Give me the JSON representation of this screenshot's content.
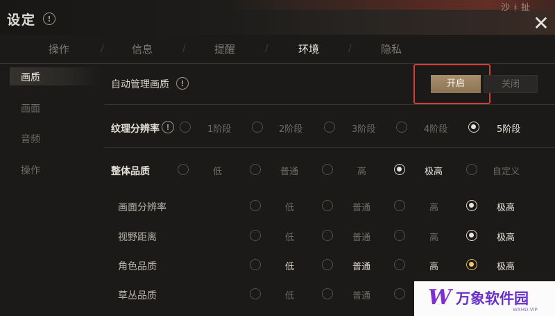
{
  "window": {
    "title": "设定",
    "info_symbol": "!",
    "close_symbol": "✕",
    "corner_text": "沙 ᚼ 扯"
  },
  "tabs": [
    {
      "label": "操作",
      "active": false
    },
    {
      "label": "信息",
      "active": false
    },
    {
      "label": "提醒",
      "active": false
    },
    {
      "label": "环境",
      "active": true
    },
    {
      "label": "隐私",
      "active": false
    }
  ],
  "tab_separator": "/",
  "sidebar": [
    {
      "label": "画质",
      "active": true
    },
    {
      "label": "画面",
      "active": false
    },
    {
      "label": "音频",
      "active": false
    },
    {
      "label": "操作",
      "active": false
    }
  ],
  "auto_quality": {
    "label": "自动管理画质",
    "on_label": "开启",
    "off_label": "关闭",
    "state": "开启"
  },
  "texture": {
    "label": "纹理分辨率",
    "options": [
      "1阶段",
      "2阶段",
      "3阶段",
      "4阶段",
      "5阶段"
    ],
    "selected": "5阶段"
  },
  "overall": {
    "label": "整体品质",
    "options": [
      "低",
      "普通",
      "高",
      "极高",
      "自定义"
    ],
    "selected": "极高"
  },
  "sub_settings": [
    {
      "label": "画面分辨率",
      "options": [
        "低",
        "普通",
        "高",
        "极高"
      ],
      "selected": "极高"
    },
    {
      "label": "视野距离",
      "options": [
        "低",
        "普通",
        "高",
        "极高"
      ],
      "selected": "极高"
    },
    {
      "label": "角色品质",
      "options": [
        "低",
        "普通",
        "高",
        "极高"
      ],
      "selected": "极高"
    },
    {
      "label": "草丛品质",
      "options": [
        "低",
        "普通"
      ],
      "selected": ""
    }
  ],
  "watermark": {
    "logo": "W",
    "name": "万象软件园",
    "url": "WXHD.VIP"
  },
  "colors": {
    "accent": "#a78e6c",
    "highlight": "#d53c36",
    "selected_gold": "#f0c66a"
  }
}
